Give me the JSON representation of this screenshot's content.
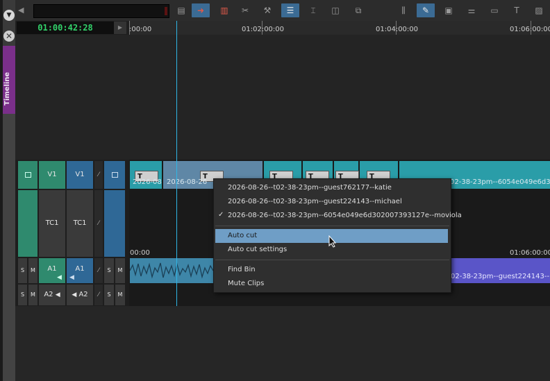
{
  "side_panel": {
    "tab_label": "Timeline"
  },
  "timecode": {
    "value": "01:00:42:28"
  },
  "ruler": {
    "labels": [
      ":00:00",
      "01:02:00:00",
      "01:04:00:00",
      "01:06:00:00"
    ]
  },
  "track_headers": {
    "v1_src": "V1",
    "v1_rec": "V1",
    "tc1_src": "TC1",
    "tc1_rec": "TC1",
    "a1_src": "A1",
    "a1_rec": "A1",
    "a2_src": "A2",
    "a2_rec": "A2",
    "solo": "S",
    "mute": "M"
  },
  "clips": {
    "t_label": "T",
    "clip1_name": "2026-08",
    "clip2_name": "2026-08-26",
    "clip_right_name": "02-38-23pm--6054e049e6d3",
    "tc_start": "00:00",
    "tc_end": "01:06:00:00",
    "audio_right_name": "02-38-23pm--guest224143--"
  },
  "context_menu": {
    "items": [
      "2026-08-26--t02-38-23pm--guest762177--katie",
      "2026-08-26--t02-38-23pm--guest224143--michael",
      "2026-08-26--t02-38-23pm--6054e049e6d302007393127e--moviola",
      "Auto cut",
      "Auto cut settings",
      "Find Bin",
      "Mute Clips"
    ],
    "checked_mark": "✓"
  },
  "colors": {
    "accent": "#3b6b94",
    "video_clip": "#2a9da8",
    "selected_clip": "#5f87a6",
    "audio_clip": "#3e86a8",
    "audio_clip_alt": "#5a55c8",
    "playhead": "#2fb6e6",
    "timecode": "#32d26a",
    "tab": "#7a2f8a"
  }
}
